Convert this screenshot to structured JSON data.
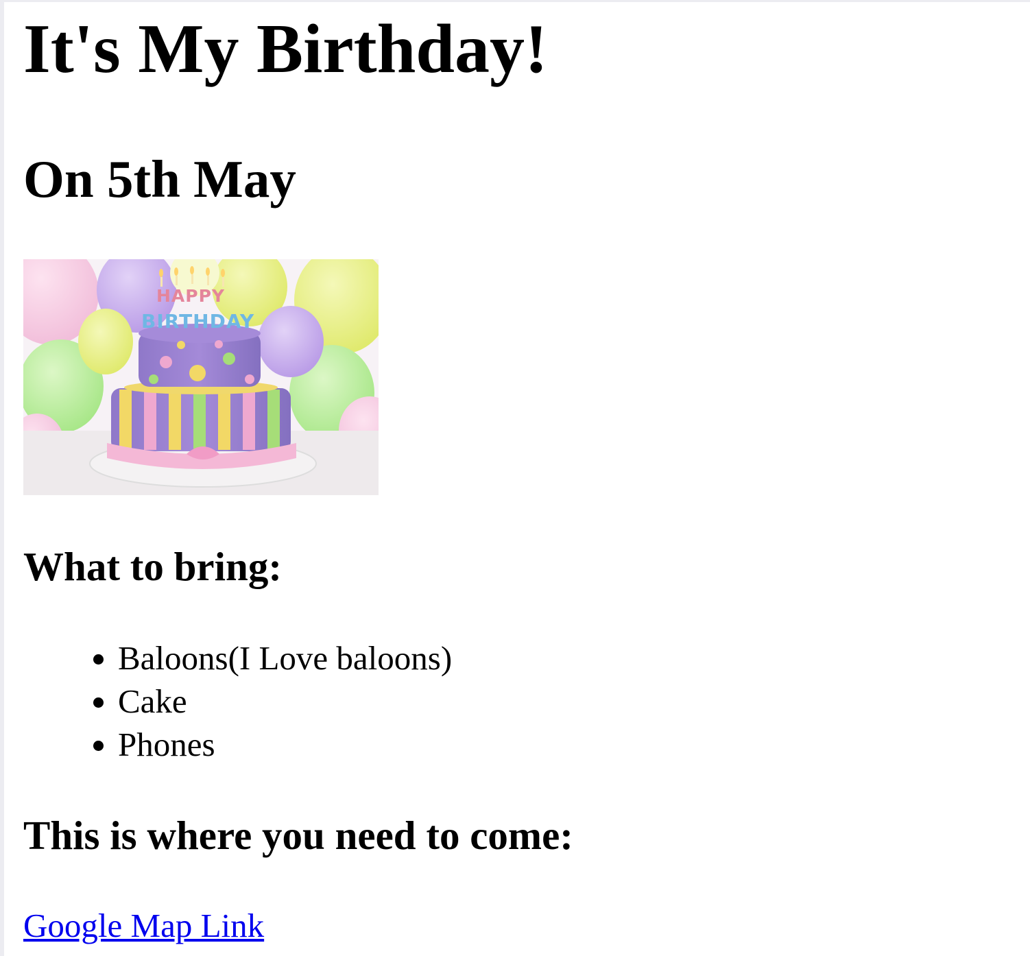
{
  "page": {
    "title": "It's My Birthday!",
    "date": "On 5th May",
    "image": {
      "alt": "Birthday cake",
      "candle_text_top": "HAPPY",
      "candle_text_bottom": "BIRTHDAY"
    },
    "bring_heading": "What to bring:",
    "bring_items": [
      "Baloons(I Love baloons)",
      "Cake",
      "Phones"
    ],
    "location_heading": "This is where you need to come:",
    "map_link_label": "Google Map Link"
  },
  "colors": {
    "link": "#0000ee",
    "text": "#000000",
    "background": "#ffffff"
  }
}
